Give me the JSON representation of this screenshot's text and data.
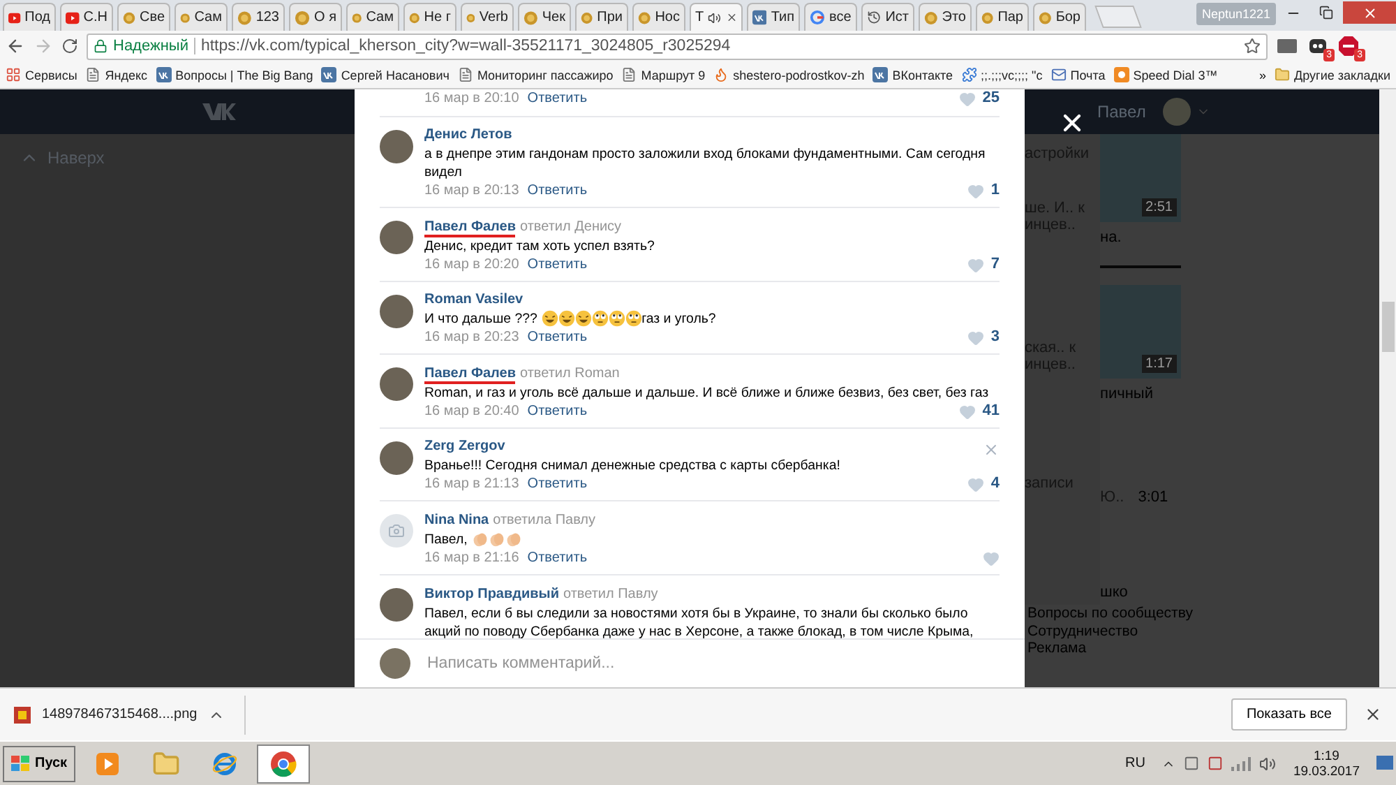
{
  "browser": {
    "tabs": [
      {
        "title": "Под",
        "kind": "youtube",
        "selected": false,
        "audio": false
      },
      {
        "title": "С.Н",
        "kind": "youtube",
        "selected": false,
        "audio": false
      },
      {
        "title": "Све",
        "kind": "coin",
        "selected": false,
        "audio": false
      },
      {
        "title": "Сам",
        "kind": "coin",
        "selected": false,
        "audio": false
      },
      {
        "title": "123",
        "kind": "coin",
        "selected": false,
        "audio": false
      },
      {
        "title": "О я",
        "kind": "coin",
        "selected": false,
        "audio": false
      },
      {
        "title": "Сам",
        "kind": "coin",
        "selected": false,
        "audio": false
      },
      {
        "title": "Не г",
        "kind": "coin",
        "selected": false,
        "audio": false
      },
      {
        "title": "Verb",
        "kind": "coin",
        "selected": false,
        "audio": false
      },
      {
        "title": "Чек",
        "kind": "coin",
        "selected": false,
        "audio": false
      },
      {
        "title": "При",
        "kind": "coin",
        "selected": false,
        "audio": false
      },
      {
        "title": "Нос",
        "kind": "coin",
        "selected": false,
        "audio": false
      },
      {
        "title": "Т",
        "kind": "plain",
        "selected": true,
        "audio": true
      },
      {
        "title": "Тип",
        "kind": "vk",
        "selected": false,
        "audio": false
      },
      {
        "title": "все",
        "kind": "google",
        "selected": false,
        "audio": false
      },
      {
        "title": "Ист",
        "kind": "history",
        "selected": false,
        "audio": false
      },
      {
        "title": "Это",
        "kind": "coin",
        "selected": false,
        "audio": false
      },
      {
        "title": "Пар",
        "kind": "coin",
        "selected": false,
        "audio": false
      },
      {
        "title": "Бор",
        "kind": "coin",
        "selected": false,
        "audio": false
      }
    ],
    "profile": "Neptun1221",
    "address": {
      "security": "Надежный",
      "url": "https://vk.com/typical_kherson_city?w=wall-35521171_3024805_r3025294"
    },
    "extensions": [
      {
        "kind": "ghost",
        "badge": "3"
      },
      {
        "kind": "adblock",
        "badge": "3"
      }
    ],
    "bookmarks": [
      {
        "label": "Сервисы",
        "kind": "apps"
      },
      {
        "label": "Яндекс",
        "kind": "page"
      },
      {
        "label": "Вопросы | The Big Bang",
        "kind": "vk"
      },
      {
        "label": "Сергей Насанович",
        "kind": "vk"
      },
      {
        "label": "Мониторинг пассажиро",
        "kind": "page"
      },
      {
        "label": "Маршрут 9",
        "kind": "page"
      },
      {
        "label": "shestero-podrostkov-zh",
        "kind": "fire"
      },
      {
        "label": "ВКонтакте",
        "kind": "vk"
      },
      {
        "label": ";;.;;;vc;;;; \"c",
        "kind": "puzzle"
      },
      {
        "label": "Почта",
        "kind": "mail"
      },
      {
        "label": "Speed Dial 3™",
        "kind": "dial"
      }
    ],
    "overflow": "»",
    "other_bookmarks": "Другие закладки"
  },
  "page": {
    "back_to_top": "Наверх",
    "user_name": "Павел",
    "side_texts": [
      "астройки",
      "ше. И.. к",
      "инцев..",
      "ская.. к",
      "инцев..",
      "записи"
    ],
    "videos": [
      {
        "duration": "2:51",
        "caption": "на."
      },
      {
        "duration": "1:17",
        "caption": "пичный"
      }
    ],
    "audio": {
      "title": "Ю..",
      "duration": "3:01"
    },
    "group_link": "шко",
    "footer_links": [
      "Вопросы по сообществу",
      "Сотрудничество",
      "Реклама"
    ]
  },
  "post_modal": {
    "comments": [
      {
        "kind": "partial",
        "date": "16 мар в 20:10",
        "reply": "Ответить",
        "likes": "25"
      },
      {
        "kind": "photo",
        "author": "Денис Летов",
        "underlined": false,
        "deletable": false,
        "parts": [
          {
            "kind": "text",
            "text": "а в днепре этим гандонам просто заложили вход блоками фундаментными. Сам сегодня видел"
          }
        ],
        "date": "16 мар в 20:13",
        "reply": "Ответить",
        "likes": "1"
      },
      {
        "kind": "photo",
        "author": "Павел Фалев",
        "reply_to": "ответил Денису",
        "underlined": true,
        "deletable": false,
        "parts": [
          {
            "kind": "text",
            "text": "Денис, кредит там хоть успел взять?"
          }
        ],
        "date": "16 мар в 20:20",
        "reply": "Ответить",
        "likes": "7"
      },
      {
        "kind": "photo",
        "author": "Roman Vasilev",
        "underlined": false,
        "deletable": false,
        "parts": [
          {
            "kind": "text",
            "text": "И что дальше ??? "
          },
          {
            "kind": "laugh"
          },
          {
            "kind": "laugh"
          },
          {
            "kind": "laugh"
          },
          {
            "kind": "rolleyes"
          },
          {
            "kind": "rolleyes"
          },
          {
            "kind": "rolleyes"
          },
          {
            "kind": "text",
            "text": "газ и уголь?"
          }
        ],
        "date": "16 мар в 20:23",
        "reply": "Ответить",
        "likes": "3"
      },
      {
        "kind": "photo",
        "author": "Павел Фалев",
        "reply_to": "ответил Roman",
        "underlined": true,
        "deletable": false,
        "parts": [
          {
            "kind": "text",
            "text": "Roman, и газ и уголь всё дальше и дальше. И всё ближе и ближе безвиз, без свет, без газ"
          }
        ],
        "date": "16 мар в 20:40",
        "reply": "Ответить",
        "likes": "41"
      },
      {
        "kind": "photo",
        "author": "Zerg Zergov",
        "underlined": false,
        "deletable": true,
        "parts": [
          {
            "kind": "text",
            "text": "Вранье!!! Сегодня снимал денежные средства с карты сбербанка!"
          }
        ],
        "date": "16 мар в 21:13",
        "reply": "Ответить",
        "likes": "4"
      },
      {
        "kind": "camera",
        "author": "Nina Nina",
        "reply_to": "ответила Павлу",
        "underlined": false,
        "deletable": false,
        "parts": [
          {
            "kind": "text",
            "text": "Павел, "
          },
          {
            "kind": "clap"
          },
          {
            "kind": "clap"
          },
          {
            "kind": "clap"
          }
        ],
        "date": "16 мар в 21:16",
        "reply": "Ответить"
      },
      {
        "kind": "photo",
        "author": "Виктор Правдивый",
        "reply_to": "ответил Павлу",
        "underlined": false,
        "deletable": false,
        "parts": [
          {
            "kind": "text",
            "text": "Павел, если б вы следили за новостями хотя бы в Украине, то знали бы сколько было акций по поводу Сбербанка даже у нас в Херсоне, а также блокад, в том числе Крыма,"
          }
        ]
      }
    ],
    "compose": {
      "placeholder": "Написать комментарий..."
    }
  },
  "downloads": {
    "file": "148978467315468....png",
    "show_all": "Показать все"
  },
  "taskbar": {
    "start": "Пуск",
    "apps": [
      {
        "kind": "media",
        "selected": false
      },
      {
        "kind": "folder",
        "selected": false
      },
      {
        "kind": "ie",
        "selected": false
      },
      {
        "kind": "chrome",
        "selected": true
      }
    ],
    "language": "RU",
    "time": "1:19",
    "date": "19.03.2017"
  }
}
